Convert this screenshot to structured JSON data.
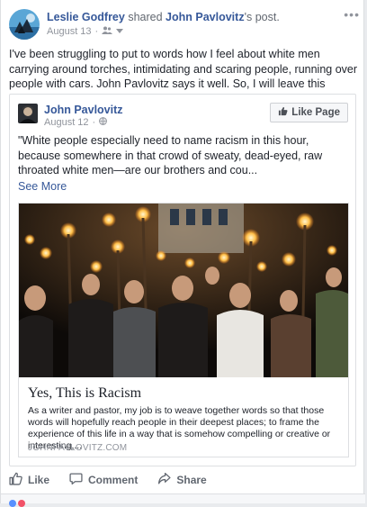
{
  "post": {
    "author": "Leslie Godfrey",
    "action": "shared",
    "shared_from": "John Pavlovitz",
    "shared_suffix": "'s post.",
    "date": "August 13",
    "audience_icon": "friends-icon",
    "body": "I've been struggling to put to words how I feel about white men carrying around torches, intimidating and scaring people, running over people with cars. John Pavlovitz says it well. So, I will leave this article here."
  },
  "shared_post": {
    "author": "John Pavlovitz",
    "date": "August 12",
    "audience_icon": "globe-icon",
    "like_page_label": "Like Page",
    "quote": "\"White people especially need to name racism in this hour, because somewhere in that crowd of sweaty, dead-eyed, raw throated white men—are our brothers and cou...",
    "see_more": "See More"
  },
  "link_card": {
    "title": "Yes, This is Racism",
    "description": "As a writer and pastor, my job is to weave together words so that those words will hopefully reach people in their deepest places; to frame the experience of this life in a way that is somehow compelling or creative or interesting,...",
    "domain": "JOHNPAVLOVITZ.COM"
  },
  "actions": {
    "like": "Like",
    "comment": "Comment",
    "share": "Share"
  },
  "colors": {
    "link": "#365899",
    "muted": "#90949c",
    "border": "#dddfe2"
  }
}
